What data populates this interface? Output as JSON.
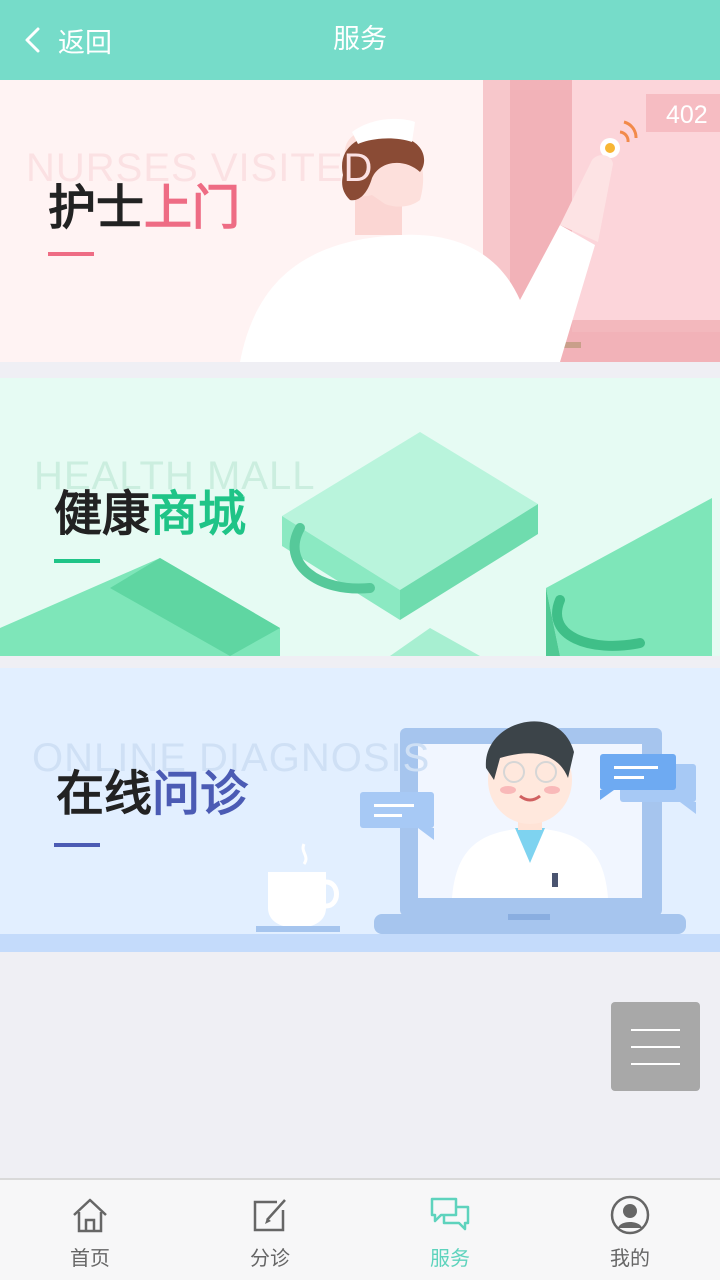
{
  "header": {
    "back_label": "返回",
    "title": "服务"
  },
  "banners": [
    {
      "watermark": "NURSES VISITED",
      "title_plain": "护士",
      "title_accent": "上门",
      "accent_color": "#ee6c84",
      "door_number": "402"
    },
    {
      "watermark": "HEALTH MALL",
      "title_plain": "健康",
      "title_accent": "商城",
      "accent_color": "#1fc487"
    },
    {
      "watermark": "ONLINE DIAGNOSIS",
      "title_plain": "在线",
      "title_accent": "问诊",
      "accent_color": "#4b5bb4"
    }
  ],
  "fab": {
    "icon": "menu-icon"
  },
  "tabbar": {
    "active_color": "#5ed3bd",
    "items": [
      {
        "label": "首页",
        "icon": "home-icon"
      },
      {
        "label": "分诊",
        "icon": "edit-icon"
      },
      {
        "label": "服务",
        "icon": "chat-icon",
        "active": true
      },
      {
        "label": "我的",
        "icon": "user-icon"
      }
    ]
  },
  "colors": {
    "header_bg": "#76dcc9",
    "page_bg": "#efeff4"
  }
}
